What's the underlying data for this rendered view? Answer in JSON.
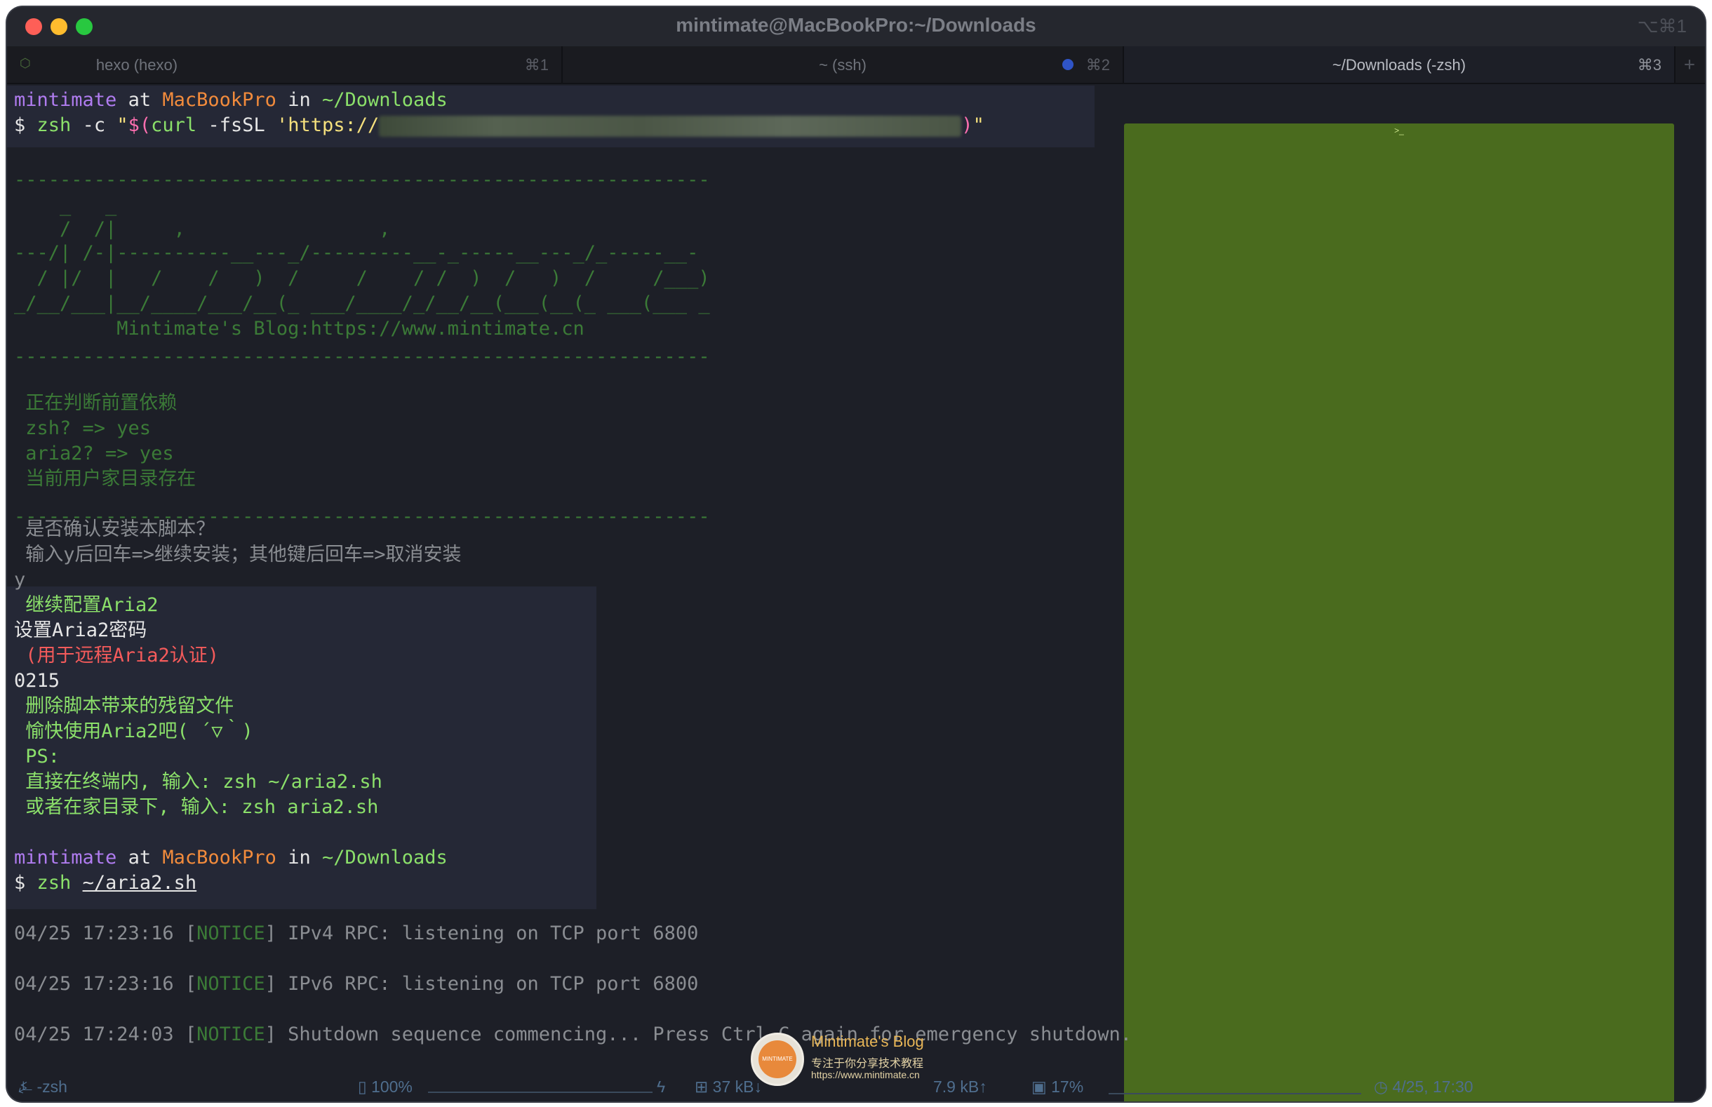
{
  "window": {
    "title": "mintimate@MacBookPro:~/Downloads",
    "title_shortcut": "⌥⌘1"
  },
  "tabs": [
    {
      "label": "hexo (hexo)",
      "shortcut": "⌘1"
    },
    {
      "label": "~ (ssh)",
      "shortcut": "⌘2"
    },
    {
      "label": "~/Downloads (-zsh)",
      "shortcut": "⌘3"
    }
  ],
  "terminal": {
    "prompt1": {
      "user": "mintimate",
      "at": "at",
      "host": "MacBookPro",
      "in": "in",
      "dir": "~/Downloads"
    },
    "command1": {
      "dollar": "$",
      "zsh": "zsh",
      "flag": "-c",
      "quote_open": "\"",
      "sub_open": "$(",
      "curl": "curl",
      "curl_flag": "-fsSL",
      "url_start": "'https://",
      "sub_close": ")",
      "quote_close": "\""
    },
    "separator": "-------------------------------------------------------------",
    "banner": [
      "    _   _",
      "    /  /|     ,                 ,",
      "---/| /-|----------__---_/---------__-_-----__---_/_-----__-",
      "  / |/  |   /    /   )  /     /    / /  )  /   )  /     /___)",
      "_/__/___|__/____/___/__(_ ___/____/_/__/__(___(__(_ ___(___ _",
      "         Mintimate's Blog:https://www.mintimate.cn"
    ],
    "checks": [
      " 正在判断前置依赖",
      " zsh? => yes",
      " aria2? => yes",
      " 当前用户家目录存在"
    ],
    "confirm": [
      " 是否确认安装本脚本？",
      " 输入y后回车=>继续安装；其他键后回车=>取消安装"
    ],
    "input_y": "y",
    "continue": " 继续配置Aria2",
    "set_password": "设置Aria2密码",
    "password_note": " (用于远程Aria2认证)",
    "password_value": "0215",
    "remove_files": " 删除脚本带来的残留文件",
    "enjoy": " 愉快使用Aria2吧( ´▽｀)",
    "ps": " PS:",
    "tip1": " 直接在终端内, 输入: zsh ~/aria2.sh",
    "tip2": " 或者在家目录下, 输入: zsh aria2.sh",
    "prompt2": {
      "user": "mintimate",
      "at": "at",
      "host": "MacBookPro",
      "in": "in",
      "dir": "~/Downloads"
    },
    "command2": {
      "dollar": "$",
      "zsh": "zsh",
      "arg": "~/aria2.sh"
    },
    "logs": [
      {
        "time": "04/25 17:23:16",
        "level": "NOTICE",
        "msg": "IPv4 RPC: listening on TCP port 6800"
      },
      {
        "time": "04/25 17:23:16",
        "level": "NOTICE",
        "msg": "IPv6 RPC: listening on TCP port 6800"
      },
      {
        "time": "04/25 17:24:03",
        "level": "NOTICE",
        "msg": "Shutdown sequence commencing... Press Ctrl-C again for emergency shutdown."
      }
    ]
  },
  "statusbar": {
    "shell": "-zsh",
    "battery": "100%",
    "download": "37 kB↓",
    "upload": "7.9 kB↑",
    "cpu": "17%",
    "clock": "4/25, 17:30"
  },
  "watermark": {
    "title": "Mintimate's Blog",
    "subtitle": "专注于你分享技术教程",
    "url": "https://www.mintimate.cn"
  }
}
